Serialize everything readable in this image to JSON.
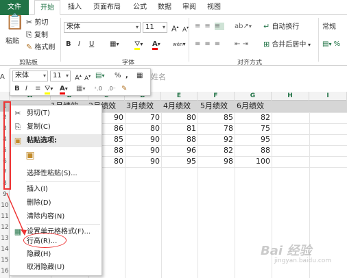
{
  "ribbon_tabs": [
    "文件",
    "开始",
    "插入",
    "页面布局",
    "公式",
    "数据",
    "审阅",
    "视图"
  ],
  "clipboard": {
    "paste": "粘贴",
    "cut": "剪切",
    "copy": "复制",
    "format_painter": "格式刷",
    "group": "剪贴板"
  },
  "font": {
    "name": "宋体",
    "size": "11",
    "grow": "A",
    "shrink": "A",
    "bold": "B",
    "italic": "I",
    "underline": "U",
    "phonetic": "wén",
    "group": "字体"
  },
  "alignment": {
    "wrap": "自动换行",
    "merge": "合并后居中",
    "group": "对齐方式"
  },
  "number": {
    "format": "常规"
  },
  "mini_toolbar": {
    "font": "宋体",
    "size": "11",
    "percent": "%",
    "comma": ","
  },
  "namebox": {
    "value": "A"
  },
  "formula_peek": "姓名",
  "columns": [
    "A",
    "B",
    "C",
    "D",
    "E",
    "F",
    "G",
    "H",
    "I"
  ],
  "rows": [
    "1",
    "2",
    "3",
    "4",
    "5",
    "6",
    "7",
    "8",
    "9",
    "10",
    "11",
    "12",
    "13",
    "14",
    "15",
    "16"
  ],
  "header_row": [
    "1月绩效",
    "2月绩效",
    "3月绩效",
    "4月绩效",
    "5月绩效",
    "6月绩效"
  ],
  "data_rows": [
    [
      "90",
      "70",
      "80",
      "85",
      "82"
    ],
    [
      "86",
      "80",
      "81",
      "78",
      "75"
    ],
    [
      "85",
      "90",
      "88",
      "92",
      "95"
    ],
    [
      "88",
      "90",
      "96",
      "82",
      "88"
    ],
    [
      "80",
      "90",
      "95",
      "98",
      "100"
    ]
  ],
  "context_menu": [
    {
      "label": "剪切(T)",
      "icon": "scissors-icon",
      "glyph": "✂"
    },
    {
      "label": "复制(C)",
      "icon": "copy-icon",
      "glyph": "⎘"
    },
    {
      "label": "粘贴选项:",
      "icon": "paste-icon",
      "glyph": "📋",
      "header": true
    },
    {
      "label": "",
      "icon": "paste-option-icon",
      "glyph": "📋"
    },
    {
      "label": "选择性粘贴(S)...",
      "icon": "",
      "glyph": ""
    },
    {
      "label": "插入(I)",
      "icon": "",
      "glyph": ""
    },
    {
      "label": "删除(D)",
      "icon": "",
      "glyph": ""
    },
    {
      "label": "清除内容(N)",
      "icon": "",
      "glyph": ""
    },
    {
      "label": "设置单元格格式(F)...",
      "icon": "format-cells-icon",
      "glyph": "▦"
    },
    {
      "label": "行高(R)...",
      "icon": "",
      "glyph": ""
    },
    {
      "label": "隐藏(H)",
      "icon": "",
      "glyph": ""
    },
    {
      "label": "取消隐藏(U)",
      "icon": "",
      "glyph": ""
    }
  ],
  "watermark": {
    "brand": "Bai 经验",
    "url": "jingyan.baidu.com"
  },
  "colors": {
    "accent": "#217346",
    "annotation": "#e33333"
  }
}
